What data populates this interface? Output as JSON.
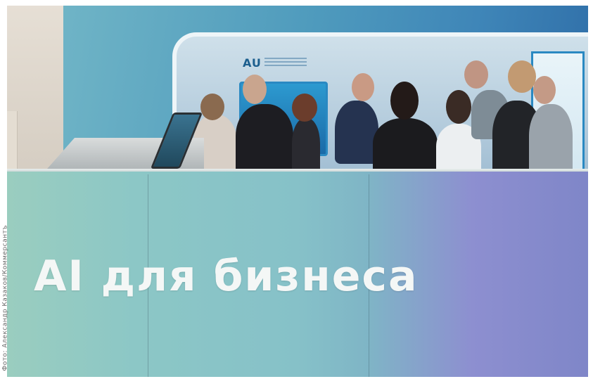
{
  "photo": {
    "headline": "AI для бизнеса",
    "inner_sign_logo": "AU",
    "credit": "Фото: Александр Казаков/Коммерсантъ"
  }
}
